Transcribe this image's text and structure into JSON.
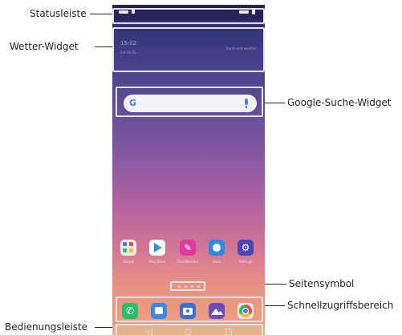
{
  "labels": {
    "statusleiste": "Statusleiste",
    "wetter_widget": "Wetter-Widget",
    "google_suche": "Google-Suche-Widget",
    "seitensymbol": "Seitensymbol",
    "schnellzugriff": "Schnellzugriffsbereich",
    "bedienungsleiste": "Bedienungsleiste"
  },
  "status": {
    "battery_icon": "battery-icon",
    "signal_icon": "signal-icon"
  },
  "weather": {
    "time": "15:02",
    "date": "Sat 04 25",
    "hint": "Tap to add weather"
  },
  "search": {
    "logo": "G",
    "mic_icon": "microphone-icon"
  },
  "apps": [
    {
      "name": "Google",
      "icon": "google-folder-icon",
      "color": "#ececec"
    },
    {
      "name": "Play Store",
      "icon": "play-store-icon",
      "color": "#ffffff"
    },
    {
      "name": "QuickMemo+",
      "icon": "quickmemo-icon",
      "color": "#e0399c"
    },
    {
      "name": "Clock",
      "icon": "clock-icon",
      "color": "#2a8be0"
    },
    {
      "name": "Settings",
      "icon": "settings-icon",
      "color": "#4a47b5"
    }
  ],
  "dock": [
    {
      "name": "Phone",
      "icon": "phone-icon",
      "color": "#2dbc6a"
    },
    {
      "name": "Messages",
      "icon": "messages-icon",
      "color": "#3a89e8"
    },
    {
      "name": "Camera",
      "icon": "camera-icon",
      "color": "#3e6fd6"
    },
    {
      "name": "Gallery",
      "icon": "gallery-icon",
      "color": "#6a4fb8"
    },
    {
      "name": "Chrome",
      "icon": "chrome-icon",
      "color": "#e8e8e8"
    }
  ],
  "nav": {
    "back": "◁",
    "home": "○",
    "recent": "□"
  },
  "colors": {
    "highlight": "#e2e2e8",
    "navbar": "#e3b38e"
  }
}
